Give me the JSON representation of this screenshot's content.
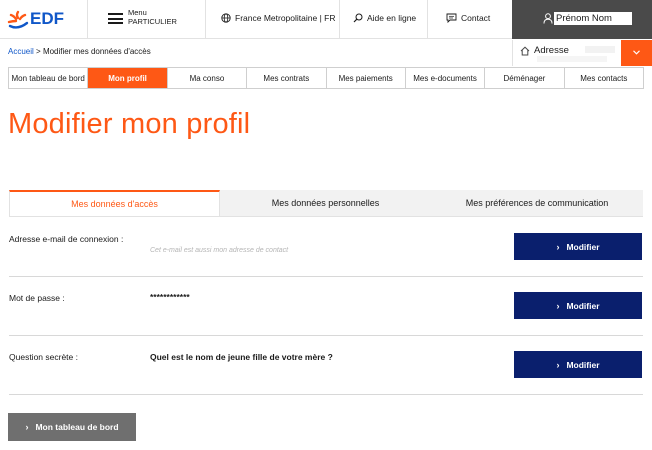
{
  "header": {
    "logo_text": "EDF",
    "menu_label_1": "Menu",
    "menu_label_2": "PARTICULIER",
    "region": "France Metropolitaine | FR",
    "help": "Aide en ligne",
    "contact": "Contact",
    "user_name": "Prénom Nom"
  },
  "address": {
    "label": "Adresse"
  },
  "breadcrumb": {
    "home": "Accueil",
    "separator": ">",
    "current": "Modifier mes données d'accès"
  },
  "nav": {
    "items": [
      {
        "label": "Mon tableau de bord",
        "active": false
      },
      {
        "label": "Mon profil",
        "active": true
      },
      {
        "label": "Ma conso",
        "active": false
      },
      {
        "label": "Mes contrats",
        "active": false
      },
      {
        "label": "Mes paiements",
        "active": false
      },
      {
        "label": "Mes e-documents",
        "active": false
      },
      {
        "label": "Déménager",
        "active": false
      },
      {
        "label": "Mes contacts",
        "active": false
      }
    ]
  },
  "page": {
    "title": "Modifier mon profil"
  },
  "subtabs": [
    {
      "label": "Mes données d'accès",
      "active": true
    },
    {
      "label": "Mes données personnelles",
      "active": false
    },
    {
      "label": "Mes préférences de communication",
      "active": false
    }
  ],
  "rows": {
    "email": {
      "label": "Adresse e-mail de connexion :",
      "hint": "Cet e-mail est aussi mon adresse de contact",
      "button": "Modifier"
    },
    "password": {
      "label": "Mot de passe :",
      "value": "************",
      "button": "Modifier"
    },
    "question": {
      "label": "Question secrète :",
      "value": "Quel est le nom de jeune fille de votre mère ?",
      "button": "Modifier"
    }
  },
  "footer": {
    "back_button": "Mon tableau de bord"
  },
  "colors": {
    "brand_orange": "#fe5815",
    "brand_blue": "#1057c8",
    "button_navy": "#0a1f6d",
    "button_grey": "#6f6f6f",
    "user_box": "#4a4a4a"
  }
}
